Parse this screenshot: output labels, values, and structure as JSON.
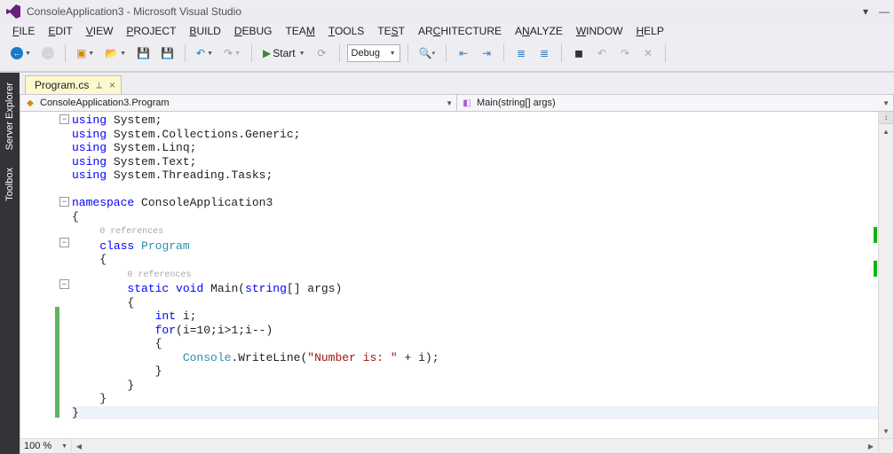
{
  "title": "ConsoleApplication3 - Microsoft Visual Studio",
  "menus": {
    "file": "FILE",
    "edit": "EDIT",
    "view": "VIEW",
    "project": "PROJECT",
    "build": "BUILD",
    "debug": "DEBUG",
    "team": "TEAM",
    "tools": "TOOLS",
    "test": "TEST",
    "arch": "ARCHITECTURE",
    "analyze": "ANALYZE",
    "window": "WINDOW",
    "help": "HELP"
  },
  "toolbar": {
    "start": "Start",
    "config": "Debug"
  },
  "side": {
    "server_explorer": "Server Explorer",
    "toolbox": "Toolbox"
  },
  "tab": {
    "name": "Program.cs"
  },
  "nav": {
    "left": "ConsoleApplication3.Program",
    "right": "Main(string[] args)"
  },
  "code": {
    "l1a": "using",
    "l1b": " System;",
    "l2a": "using",
    "l2b": " System.Collections.Generic;",
    "l3a": "using",
    "l3b": " System.Linq;",
    "l4a": "using",
    "l4b": " System.Text;",
    "l5a": "using",
    "l5b": " System.Threading.Tasks;",
    "blank": "",
    "ns_a": "namespace",
    "ns_b": " ConsoleApplication3",
    "ob": "{",
    "ref": "0 references",
    "cls_a": "    ",
    "cls_b": "class",
    "cls_c": " ",
    "cls_d": "Program",
    "ob2": "    {",
    "m_a": "        ",
    "m_b": "static",
    "m_sp": " ",
    "m_c": "void",
    "m_d": " Main(",
    "m_e": "string",
    "m_f": "[] args)",
    "ob3": "        {",
    "int_a": "            ",
    "int_b": "int",
    "int_c": " i;",
    "for_a": "            ",
    "for_b": "for",
    "for_c": "(i=10;i>1;i--)",
    "ob4": "            {",
    "cw_a": "                ",
    "cw_b": "Console",
    "cw_c": ".WriteLine(",
    "cw_d": "\"Number is: \"",
    "cw_e": " + i);",
    "cb4": "            }",
    "cb3": "        }",
    "cb2": "    }",
    "cb": "}"
  },
  "zoom": "100 %"
}
